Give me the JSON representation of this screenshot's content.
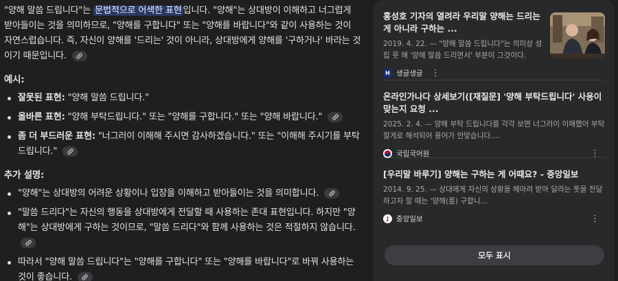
{
  "answer": {
    "intro": {
      "p1": "\"양해 말씀 드립니다\"는 ",
      "highlight": "문법적으로 어색한 표현",
      "p2": "입니다. \"양해\"는 상대방이 이해하고 너그럽게 받아들이는 것을 의미하므로, \"양해를 구합니다\" 또는 \"양해를 바랍니다\"와 같이 사용하는 것이 자연스럽습니다. 즉, 자신이 양해를 '드리는' 것이 아니라, 상대방에게 양해를 '구하거나' 바라는 것이기 때문입니다."
    },
    "examples_heading": "예시:",
    "examples": [
      {
        "label": "잘못된 표현:",
        "text": " \"양해 말씀 드립니다.\""
      },
      {
        "label": "올바른 표현:",
        "text": " \"양해 부탁드립니다.\" 또는 \"양해를 구합니다.\" 또는 \"양해 바랍니다.\""
      },
      {
        "label": "좀 더 부드러운 표현:",
        "text": " \"너그러이 이해해 주시면 감사하겠습니다.\" 또는 \"이해해 주시기를 부탁드립니다.\""
      }
    ],
    "extra_heading": "추가 설명:",
    "extra": [
      "\"양해\"는 상대방의 어려운 상황이나 입장을 이해하고 받아들이는 것을 의미합니다.",
      "\"말씀 드리다\"는 자신의 행동을 상대방에게 전달할 때 사용하는 존대 표현입니다. 하지만 \"양해\"는 상대방에게 구하는 것이므로, \"말씀 드리다\"와 함께 사용하는 것은 적절하지 않습니다.",
      "따라서 \"양해 말씀 드립니다\"는 \"양해를 구합니다\" 또는 \"양해를 바랍니다\"로 바꿔 사용하는 것이 좋습니다."
    ]
  },
  "sources": [
    {
      "title": "홍성호 기자의 열려라 우리말 양해는 드리는 게 아니라 구하는 ...",
      "snippet": "2019. 4. 22. — \"양해 말씀 드립니다\"는 의미상 성립 못 해 '양해 말씀 드리면서' 부분이 그것이다.",
      "site": "생글생글",
      "favicon_letter": "H",
      "favicon_color": "#1a2b6d"
    },
    {
      "title": "온라인가나다 상세보기([재질문] '양해 부탁드립니다' 사용이 맞는지 요청 ...",
      "snippet": "2025. 2. 4. — 양해 부탁 드립니다를 각각 보면 너그러이 이해했어 부탁 할게로 해석되어 용어가 안맞습니다....",
      "site": "국립국어원",
      "favicon_letter": "",
      "favicon_color": "#ffffff"
    },
    {
      "title": "[우리말 바루기] 양해는 구하는 게 어때요? - 중앙일보",
      "snippet": "2014. 9. 25. — 상대에게 자신의 상황을 헤아려 받아 달라는 뜻을 전달하고자 할 때는 '양해(를) 구합니...",
      "site": "중앙일보",
      "favicon_letter": "J",
      "favicon_color": "#ffffff"
    }
  ],
  "show_all_label": "모두 표시",
  "icons": {
    "link": "link-icon",
    "kebab": "more-vert-icon"
  }
}
